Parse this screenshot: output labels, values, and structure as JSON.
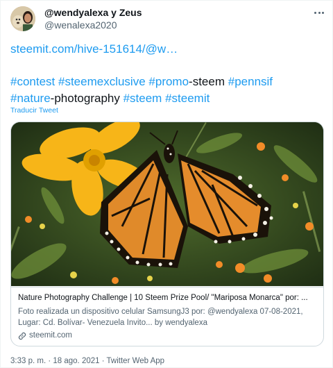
{
  "author": {
    "display_name": "@wendyalexa y Zeus",
    "handle": "@wenalexa2020",
    "avatar": "avatar"
  },
  "more_icon": "more-horizontal-icon",
  "text": {
    "url": "steemit.com/hive-151614/@w…",
    "hashtag_contest": "#contest",
    "hashtag_steemexclusive": "#steemexclusive",
    "hashtag_promo": "#promo",
    "plain_steem": "-steem",
    "hashtag_pennsif": "#pennsif",
    "hashtag_nature": "#nature",
    "plain_photography": "-photography",
    "hashtag_steem": "#steem",
    "hashtag_steemit": "#steemit"
  },
  "translate_label": "Traducir Tweet",
  "card": {
    "title": "Nature Photography Challenge | 10 Steem Prize Pool/ \"Mariposa Monarca\" por: ...",
    "description": "Foto realizada un dispositivo celular SamsungJ3 por: @wendyalexa 07-08-2021, Lugar: Cd. Bolívar- Venezuela Invito... by wendyalexa",
    "domain": "steemit.com",
    "link_icon": "link-icon",
    "image": "monarch-butterfly-photo"
  },
  "meta": {
    "time": "3:33 p. m.",
    "separator1": " · ",
    "date": "18 ago. 2021",
    "separator2": " · ",
    "source": "Twitter Web App"
  },
  "colors": {
    "link": "#1d9bf0",
    "text": "#0f1419",
    "secondary": "#536471",
    "border": "#cfd9de"
  }
}
